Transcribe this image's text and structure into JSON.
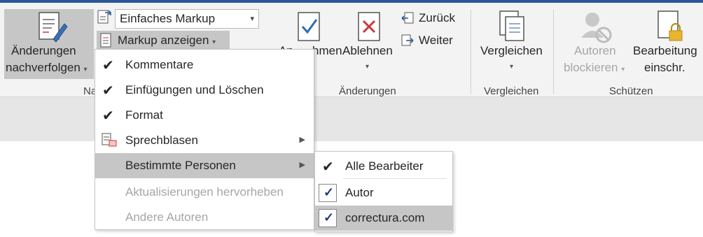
{
  "colors": {
    "accent": "#2b579a",
    "highlight": "#c6c6c6",
    "reject": "#d13438",
    "accept": "#2b6cb0"
  },
  "ribbon": {
    "track_changes": {
      "line1": "Änderungen",
      "line2": "nachverfolgen",
      "caret": "▾"
    },
    "markup_combo": {
      "value": "Einfaches Markup",
      "caret": "▾"
    },
    "show_markup": {
      "label": "Markup anzeigen",
      "caret": "▾"
    },
    "accept": {
      "label_visible": "An",
      "label_tail": "hmen"
    },
    "reject": {
      "label": "Ablehnen",
      "caret": "▾"
    },
    "previous": {
      "label": "Zurück"
    },
    "next": {
      "label": "Weiter"
    },
    "compare": {
      "label": "Vergleichen",
      "caret": "▾"
    },
    "block_authors": {
      "line1": "Autoren",
      "line2": "blockieren",
      "caret": "▾"
    },
    "restrict_editing": {
      "line1": "Bearbeitung",
      "line2": "einschr."
    },
    "groups": {
      "tracking": "Na",
      "changes": "Änderungen",
      "compare": "Vergleichen",
      "protect": "Schützen"
    }
  },
  "menu": {
    "items": [
      {
        "label": "Kommentare",
        "checked": true
      },
      {
        "label": "Einfügungen und Löschen",
        "checked": true
      },
      {
        "label": "Format",
        "checked": true
      },
      {
        "label": "Sprechblasen",
        "icon": "balloon-icon",
        "submenu": true
      },
      {
        "label": "Bestimmte Personen",
        "submenu": true,
        "hover": true
      },
      {
        "label": "Aktualisierungen hervorheben",
        "disabled": true
      },
      {
        "label": "Andere Autoren",
        "disabled": true
      }
    ],
    "check_glyph": "✔",
    "arrow_glyph": "▶"
  },
  "submenu": {
    "items": [
      {
        "label": "Alle Bearbeiter",
        "checked": true
      },
      {
        "label": "Autor",
        "checked": true
      },
      {
        "label": "correctura.com",
        "checked": true,
        "hover": true
      }
    ],
    "check_glyph": "✔",
    "box_check_glyph": "✓"
  }
}
